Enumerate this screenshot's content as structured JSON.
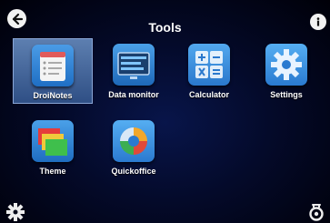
{
  "header": {
    "title": "Tools"
  },
  "apps": [
    {
      "label": "DroiNotes",
      "icon": "notepad-icon",
      "selected": true
    },
    {
      "label": "Data monitor",
      "icon": "data-monitor-icon",
      "selected": false
    },
    {
      "label": "Calculator",
      "icon": "calculator-icon",
      "selected": false
    },
    {
      "label": "Settings",
      "icon": "gear-icon",
      "selected": false
    },
    {
      "label": "Theme",
      "icon": "theme-icon",
      "selected": false
    },
    {
      "label": "Quickoffice",
      "icon": "quickoffice-icon",
      "selected": false
    }
  ],
  "colors": {
    "selection": "#4a6ea8",
    "background": "#040a2a",
    "tile_blue": "#2f86d6"
  }
}
